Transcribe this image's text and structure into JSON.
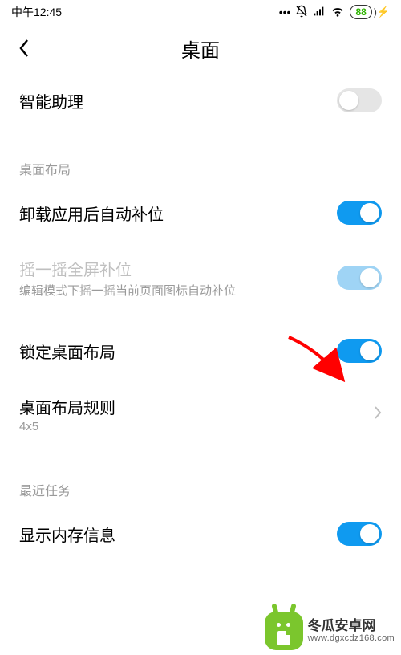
{
  "status_bar": {
    "time": "中午12:45",
    "battery": "88"
  },
  "header": {
    "title": "桌面"
  },
  "rows": {
    "smart_assistant": {
      "label": "智能助理"
    },
    "section_layout": {
      "label": "桌面布局"
    },
    "auto_fill": {
      "label": "卸载应用后自动补位"
    },
    "shake_fill": {
      "label": "摇一摇全屏补位",
      "sub": "编辑模式下摇一摇当前页面图标自动补位"
    },
    "lock_layout": {
      "label": "锁定桌面布局"
    },
    "layout_rules": {
      "label": "桌面布局规则",
      "sub": "4x5"
    },
    "section_recent": {
      "label": "最近任务"
    },
    "show_memory": {
      "label": "显示内存信息"
    }
  },
  "watermark": {
    "name": "冬瓜安卓网",
    "url": "www.dgxcdz168.com"
  }
}
